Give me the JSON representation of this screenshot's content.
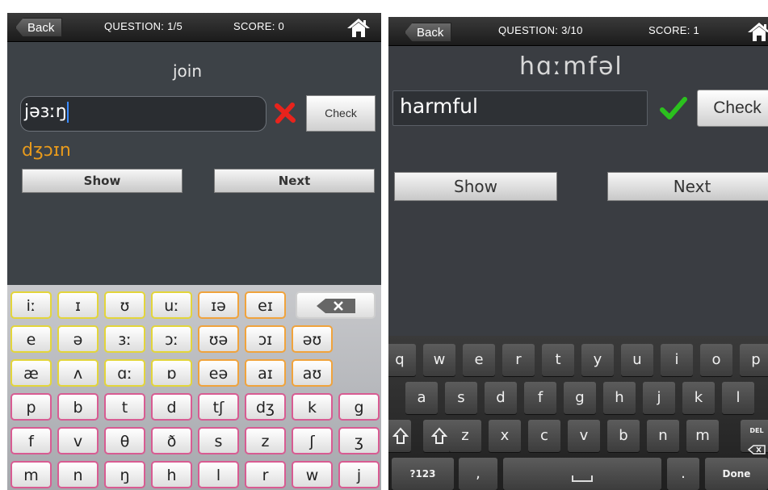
{
  "left": {
    "topbar": {
      "back_label": "Back",
      "question": "QUESTION: 1/5",
      "score": "SCORE: 0"
    },
    "word": "join",
    "input_value": "jəɜːŋ",
    "result": "wrong",
    "correct_answer": "dʒɔɪn",
    "check_label": "Check",
    "show_label": "Show",
    "next_label": "Next",
    "keyboard_rows": [
      [
        "iː",
        "ɪ",
        "ʊ",
        "uː",
        "ɪə",
        "eɪ"
      ],
      [
        "e",
        "ə",
        "ɜː",
        "ɔː",
        "ʊə",
        "ɔɪ",
        "əʊ"
      ],
      [
        "æ",
        "ʌ",
        "ɑː",
        "ɒ",
        "eə",
        "aɪ",
        "aʊ"
      ],
      [
        "p",
        "b",
        "t",
        "d",
        "tʃ",
        "dʒ",
        "k",
        "g"
      ],
      [
        "f",
        "v",
        "θ",
        "ð",
        "s",
        "z",
        "ʃ",
        "ʒ"
      ],
      [
        "m",
        "n",
        "ŋ",
        "h",
        "l",
        "r",
        "w",
        "j"
      ]
    ],
    "delete_icon": "backspace-icon"
  },
  "right": {
    "topbar": {
      "back_label": "Back",
      "question": "QUESTION: 3/10",
      "score": "SCORE: 1"
    },
    "phonetic": "hɑːmfəl",
    "input_value": "harmful",
    "result": "correct",
    "check_label": "Check",
    "show_label": "Show",
    "next_label": "Next",
    "keyboard_rows": [
      [
        "q",
        "w",
        "e",
        "r",
        "t",
        "y",
        "u",
        "i",
        "o",
        "p"
      ],
      [
        "a",
        "s",
        "d",
        "f",
        "g",
        "h",
        "j",
        "k",
        "l"
      ],
      [
        "z",
        "x",
        "c",
        "v",
        "b",
        "n",
        "m"
      ]
    ],
    "key_123": "?123",
    "key_comma": ",",
    "key_period": ".",
    "key_done": "Done",
    "key_del": "DEL"
  },
  "colors": {
    "wrong": "#e8231c",
    "correct": "#2bc11e",
    "answer_orange": "#e89a1c",
    "caret": "#3b8cff"
  }
}
